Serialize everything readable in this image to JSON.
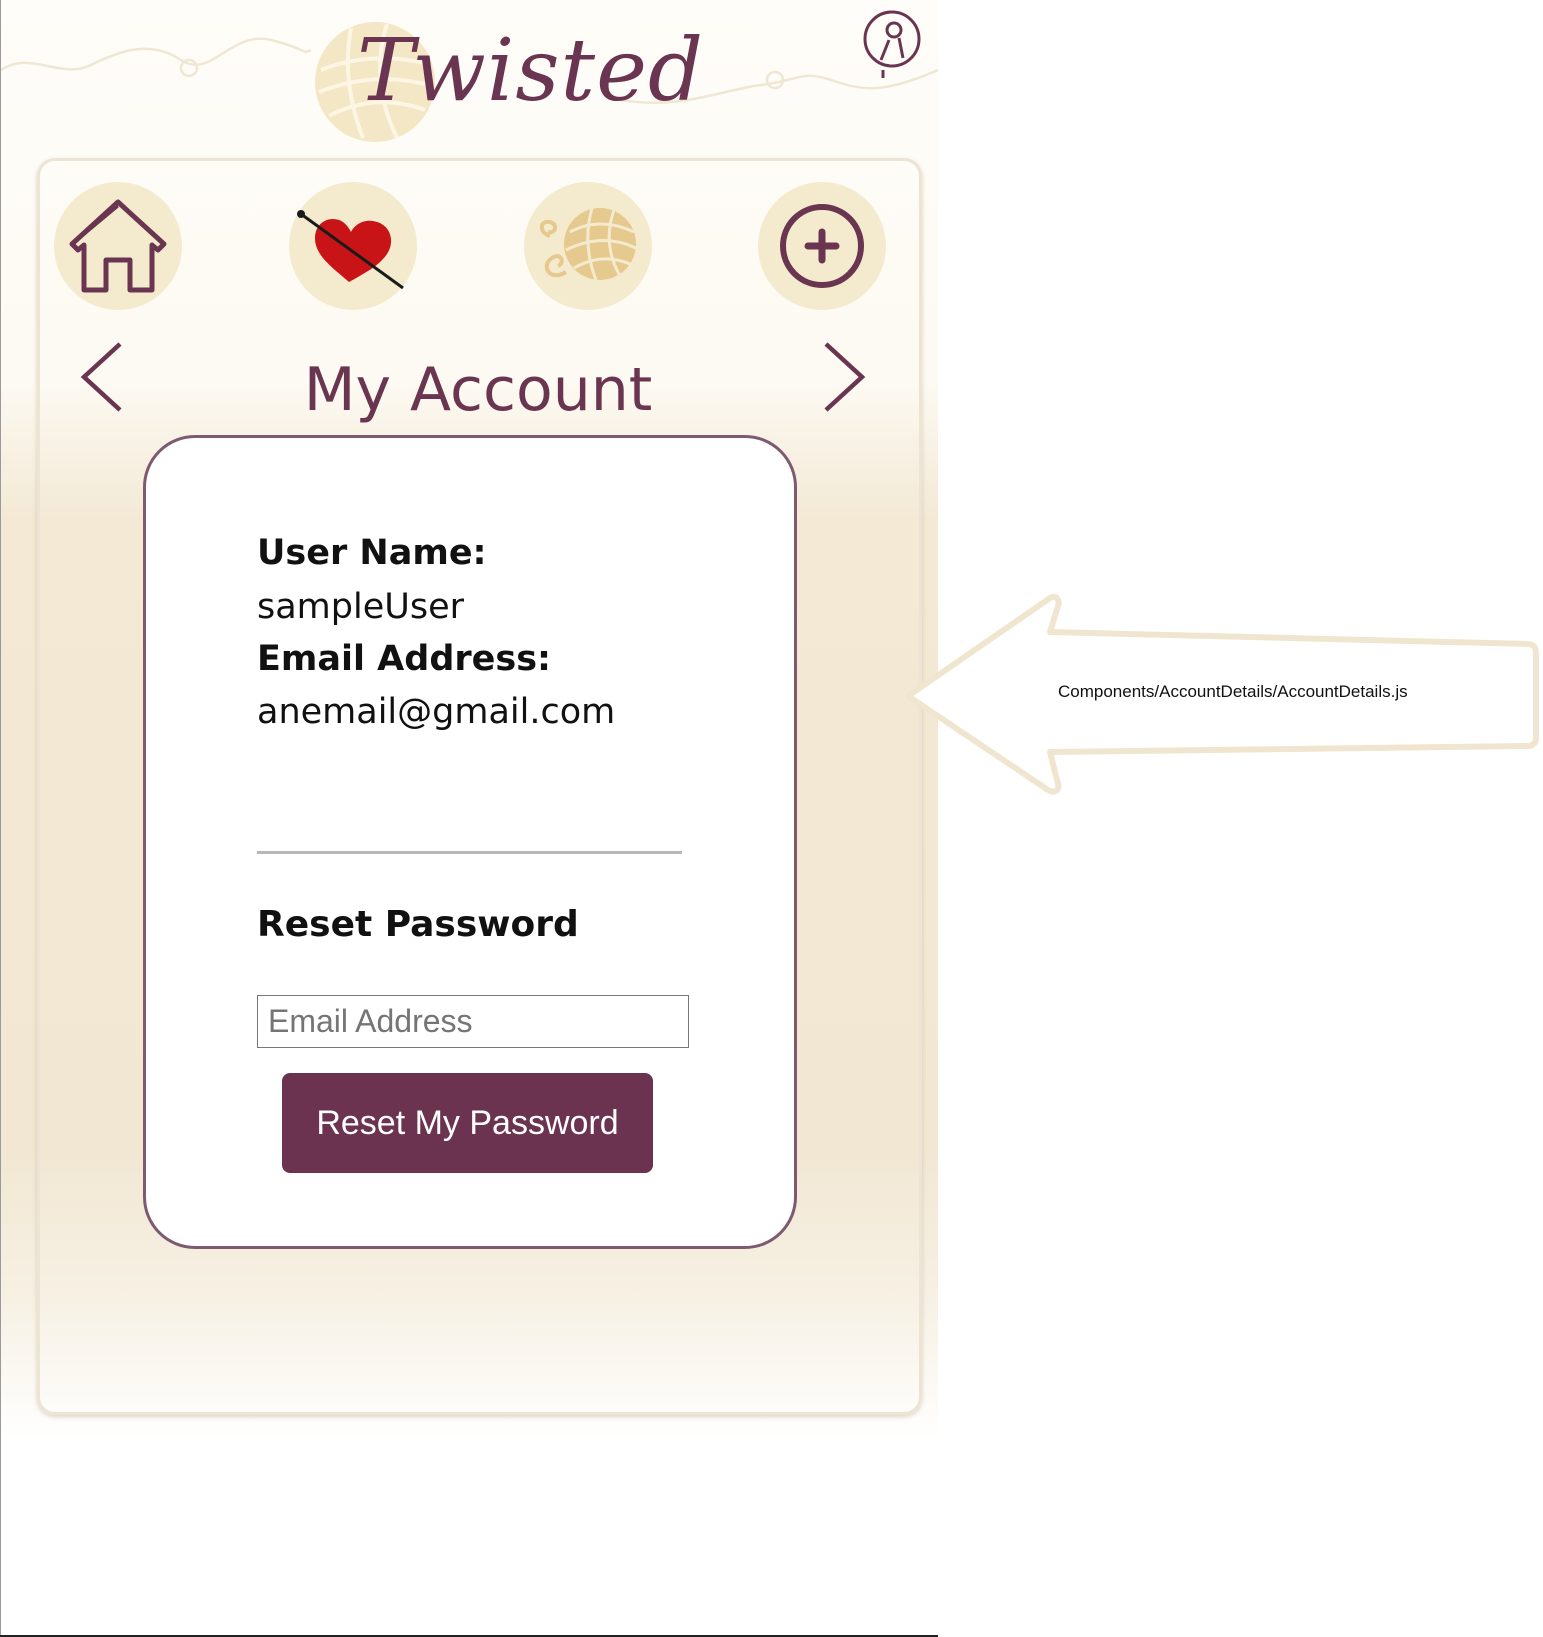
{
  "app": {
    "logo_text": "Twisted"
  },
  "header": {
    "profile_icon": "user-profile-icon"
  },
  "nav": {
    "items": [
      {
        "icon": "home-icon"
      },
      {
        "icon": "heart-needle-icon"
      },
      {
        "icon": "yarn-ball-icon"
      },
      {
        "icon": "plus-circle-icon"
      }
    ],
    "prev_icon": "chevron-left-icon",
    "next_icon": "chevron-right-icon"
  },
  "page": {
    "title": "My Account"
  },
  "account": {
    "username_label": "User Name:",
    "username_value": "sampleUser",
    "email_label": "Email Address:",
    "email_value": "anemail@gmail.com"
  },
  "reset": {
    "heading": "Reset Password",
    "email_placeholder": "Email Address",
    "email_value": "",
    "button_label": "Reset My Password"
  },
  "annotation": {
    "text": "Components/AccountDetails/AccountDetails.js"
  },
  "colors": {
    "brand": "#6a3550",
    "nav_circle": "#f4ebce",
    "yarn": "#e5c98f",
    "heart": "#c81416",
    "button_bg": "#6b3350"
  }
}
